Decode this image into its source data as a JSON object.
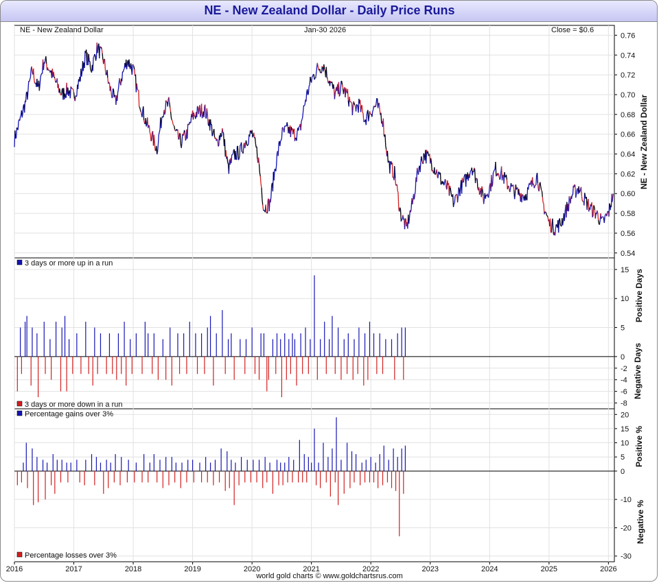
{
  "title": "NE - New Zealand Dollar - Daily Price Runs",
  "credit": "world gold charts © www.goldchartsrus.com",
  "colors": {
    "up": "#1414b4",
    "down": "#d21e1e",
    "price": "#000000",
    "title": "#1a1a9a",
    "grid": "#e1e1e1"
  },
  "chart_data": [
    {
      "type": "line",
      "info_left": "NE - New Zealand Dollar",
      "info_center": "Jan-30  2026",
      "info_right": "Close = $0.6",
      "ylabel": "NE - New Zealand Dollar",
      "ylim": [
        0.535,
        0.77
      ],
      "yticks": [
        "0.76",
        "0.74",
        "0.72",
        "0.70",
        "0.68",
        "0.66",
        "0.64",
        "0.62",
        "0.60",
        "0.58",
        "0.56",
        "0.54"
      ],
      "xticks": [
        "2016",
        "2017",
        "2018",
        "2019",
        "2020",
        "2021",
        "2022",
        "2023",
        "2024",
        "2025",
        "2026"
      ],
      "xlim": [
        2016.0,
        2026.1
      ],
      "series": [
        {
          "x": [
            2016.0,
            2016.1,
            2016.2,
            2016.3,
            2016.4,
            2016.5,
            2016.6,
            2016.7,
            2016.8,
            2016.9,
            2017.0,
            2017.1,
            2017.2,
            2017.3,
            2017.4,
            2017.5,
            2017.6,
            2017.7,
            2017.8,
            2017.9,
            2018.0,
            2018.1,
            2018.2,
            2018.3,
            2018.4,
            2018.5,
            2018.6,
            2018.7,
            2018.8,
            2018.9,
            2019.0,
            2019.1,
            2019.2,
            2019.3,
            2019.4,
            2019.5,
            2019.6,
            2019.7,
            2019.8,
            2019.9,
            2020.0,
            2020.1,
            2020.2,
            2020.3,
            2020.4,
            2020.5,
            2020.6,
            2020.7,
            2020.8,
            2020.9,
            2021.0,
            2021.1,
            2021.2,
            2021.3,
            2021.4,
            2021.5,
            2021.6,
            2021.7,
            2021.8,
            2021.9,
            2022.0,
            2022.1,
            2022.2,
            2022.3,
            2022.4,
            2022.5,
            2022.6,
            2022.7,
            2022.8,
            2022.9,
            2023.0,
            2023.1,
            2023.2,
            2023.3,
            2023.4,
            2023.5,
            2023.6,
            2023.7,
            2023.8,
            2023.9,
            2024.0,
            2024.1,
            2024.2,
            2024.3,
            2024.4,
            2024.5,
            2024.6,
            2024.7,
            2024.8,
            2024.9,
            2025.0,
            2025.1,
            2025.2,
            2025.3,
            2025.4,
            2025.5,
            2025.6,
            2025.7,
            2025.8,
            2025.9,
            2026.0,
            2026.08
          ],
          "y": [
            0.655,
            0.675,
            0.695,
            0.725,
            0.705,
            0.735,
            0.725,
            0.712,
            0.7,
            0.705,
            0.698,
            0.715,
            0.74,
            0.727,
            0.748,
            0.735,
            0.708,
            0.692,
            0.717,
            0.735,
            0.725,
            0.695,
            0.675,
            0.66,
            0.645,
            0.685,
            0.69,
            0.662,
            0.652,
            0.66,
            0.678,
            0.683,
            0.685,
            0.67,
            0.65,
            0.664,
            0.625,
            0.639,
            0.642,
            0.654,
            0.661,
            0.638,
            0.585,
            0.59,
            0.63,
            0.66,
            0.665,
            0.66,
            0.662,
            0.695,
            0.715,
            0.726,
            0.73,
            0.715,
            0.7,
            0.708,
            0.7,
            0.685,
            0.69,
            0.675,
            0.683,
            0.69,
            0.675,
            0.63,
            0.62,
            0.58,
            0.565,
            0.59,
            0.625,
            0.64,
            0.634,
            0.623,
            0.612,
            0.605,
            0.59,
            0.605,
            0.614,
            0.628,
            0.611,
            0.595,
            0.606,
            0.625,
            0.62,
            0.61,
            0.603,
            0.6,
            0.598,
            0.608,
            0.618,
            0.59,
            0.57,
            0.565,
            0.57,
            0.585,
            0.6,
            0.606,
            0.594,
            0.585,
            0.58,
            0.57,
            0.58,
            0.6
          ]
        }
      ]
    },
    {
      "type": "bar",
      "legend_top": "3 days or more up in a run",
      "legend_bottom": "3 days or more down in a run",
      "ylabel_top": "Positive Days",
      "ylabel_bottom": "Negative Days",
      "ylim": [
        -9,
        17
      ],
      "yticks": [
        "15",
        "10",
        "5",
        "0",
        "-2",
        "-4",
        "-6",
        "-8"
      ],
      "series": [
        {
          "name": "3 days or more up in a run",
          "x": [
            2016.1,
            2016.18,
            2016.21,
            2016.3,
            2016.38,
            2016.5,
            2016.6,
            2016.7,
            2016.8,
            2016.85,
            2016.92,
            2017.05,
            2017.2,
            2017.35,
            2017.45,
            2017.6,
            2017.75,
            2017.85,
            2017.95,
            2018.05,
            2018.2,
            2018.25,
            2018.35,
            2018.5,
            2018.62,
            2018.75,
            2018.85,
            2018.95,
            2019.05,
            2019.15,
            2019.25,
            2019.3,
            2019.4,
            2019.5,
            2019.6,
            2019.65,
            2019.8,
            2019.9,
            2020.0,
            2020.15,
            2020.2,
            2020.35,
            2020.42,
            2020.48,
            2020.55,
            2020.62,
            2020.68,
            2020.72,
            2020.82,
            2020.9,
            2020.98,
            2021.05,
            2021.15,
            2021.22,
            2021.3,
            2021.35,
            2021.45,
            2021.55,
            2021.62,
            2021.72,
            2021.8,
            2021.9,
            2021.98,
            2022.05,
            2022.15,
            2022.25,
            2022.35,
            2022.45,
            2022.52,
            2022.58
          ],
          "y": [
            5,
            6,
            7,
            5,
            4,
            6,
            3,
            6,
            5,
            7,
            3,
            4,
            6,
            5,
            4,
            4,
            4,
            6,
            3,
            4,
            6,
            4,
            4,
            3,
            5,
            4,
            4,
            6,
            4,
            4,
            5,
            7,
            4,
            8,
            3,
            4,
            3,
            3,
            5,
            4,
            4,
            3,
            4,
            3,
            4,
            3,
            4,
            3,
            4,
            5,
            3,
            14,
            3,
            6,
            3,
            7,
            5,
            3,
            4,
            3,
            5,
            4,
            6,
            4,
            4,
            3,
            3,
            4,
            5,
            5
          ]
        },
        {
          "name": "3 days or more down in a run",
          "x": [
            2016.05,
            2016.12,
            2016.28,
            2016.4,
            2016.52,
            2016.62,
            2016.78,
            2016.88,
            2016.98,
            2017.12,
            2017.25,
            2017.32,
            2017.4,
            2017.55,
            2017.65,
            2017.72,
            2017.8,
            2017.88,
            2017.98,
            2018.15,
            2018.32,
            2018.42,
            2018.55,
            2018.65,
            2018.78,
            2018.9,
            2019.08,
            2019.2,
            2019.35,
            2019.55,
            2019.7,
            2019.88,
            2020.05,
            2020.12,
            2020.25,
            2020.28,
            2020.4,
            2020.5,
            2020.58,
            2020.65,
            2020.75,
            2020.85,
            2020.95,
            2021.1,
            2021.25,
            2021.4,
            2021.5,
            2021.6,
            2021.7,
            2021.78,
            2021.88,
            2021.95,
            2022.1,
            2022.2,
            2022.4,
            2022.55
          ],
          "y": [
            -6,
            -3,
            -5,
            -7,
            -3,
            -4,
            -6,
            -6,
            -3,
            -3,
            -3,
            -5,
            -3,
            -3,
            -3,
            -4,
            -3,
            -5,
            -3,
            -3,
            -3,
            -4,
            -4,
            -5,
            -3,
            -3,
            -3,
            -3,
            -5,
            -3,
            -4,
            -3,
            -3,
            -4,
            -6,
            -4,
            -3,
            -7,
            -4,
            -3,
            -5,
            -3,
            -3,
            -4,
            -3,
            -3,
            -4,
            -3,
            -4,
            -3,
            -5,
            -4,
            -3,
            -3,
            -4,
            -4
          ]
        }
      ]
    },
    {
      "type": "bar",
      "legend_top": "Percentage gains over 3%",
      "legend_bottom": "Percentage losses over 3%",
      "ylabel_top": "Positive %",
      "ylabel_bottom": "Negative %",
      "ylim": [
        -32,
        22
      ],
      "yticks": [
        "20",
        "15",
        "10",
        "5",
        "0",
        "-10",
        "-20",
        "-30"
      ],
      "series": [
        {
          "name": "Percentage gains over 3%",
          "x": [
            2016.15,
            2016.2,
            2016.3,
            2016.38,
            2016.48,
            2016.55,
            2016.65,
            2016.72,
            2016.8,
            2016.88,
            2016.95,
            2017.05,
            2017.2,
            2017.3,
            2017.38,
            2017.45,
            2017.55,
            2017.62,
            2017.7,
            2017.8,
            2017.92,
            2018.05,
            2018.18,
            2018.28,
            2018.35,
            2018.45,
            2018.55,
            2018.65,
            2018.72,
            2018.82,
            2018.92,
            2019.0,
            2019.12,
            2019.22,
            2019.3,
            2019.38,
            2019.48,
            2019.58,
            2019.65,
            2019.72,
            2019.82,
            2019.92,
            2020.02,
            2020.12,
            2020.22,
            2020.3,
            2020.42,
            2020.48,
            2020.55,
            2020.62,
            2020.7,
            2020.8,
            2020.88,
            2020.95,
            2021.0,
            2021.05,
            2021.12,
            2021.2,
            2021.28,
            2021.35,
            2021.42,
            2021.5,
            2021.6,
            2021.68,
            2021.75,
            2021.85,
            2021.92,
            2022.0,
            2022.08,
            2022.15,
            2022.22,
            2022.3,
            2022.38,
            2022.45,
            2022.52,
            2022.58
          ],
          "y": [
            3,
            10,
            8,
            5,
            4,
            3,
            6,
            4,
            4,
            3,
            3,
            4,
            4,
            6,
            5,
            3,
            4,
            3,
            6,
            5,
            4,
            3,
            6,
            3,
            6,
            4,
            5,
            5,
            3,
            3,
            4,
            4,
            3,
            5,
            3,
            4,
            8,
            7,
            4,
            3,
            5,
            4,
            4,
            4,
            5,
            3,
            4,
            3,
            3,
            5,
            4,
            11,
            6,
            5,
            3,
            15,
            3,
            10,
            5,
            8,
            19,
            4,
            10,
            7,
            6,
            3,
            4,
            5,
            3,
            6,
            9,
            4,
            8,
            5,
            8,
            9
          ]
        },
        {
          "name": "Percentage losses over 3%",
          "x": [
            2016.05,
            2016.12,
            2016.22,
            2016.32,
            2016.4,
            2016.52,
            2016.62,
            2016.68,
            2016.78,
            2016.9,
            2017.1,
            2017.18,
            2017.35,
            2017.5,
            2017.58,
            2017.68,
            2017.78,
            2017.9,
            2018.02,
            2018.15,
            2018.25,
            2018.4,
            2018.5,
            2018.6,
            2018.7,
            2018.8,
            2018.9,
            2019.02,
            2019.15,
            2019.25,
            2019.35,
            2019.45,
            2019.55,
            2019.62,
            2019.7,
            2019.78,
            2019.88,
            2019.98,
            2020.08,
            2020.18,
            2020.25,
            2020.35,
            2020.45,
            2020.52,
            2020.6,
            2020.68,
            2020.78,
            2020.85,
            2020.92,
            2021.08,
            2021.15,
            2021.25,
            2021.32,
            2021.4,
            2021.45,
            2021.55,
            2021.65,
            2021.72,
            2021.82,
            2021.9,
            2021.98,
            2022.05,
            2022.12,
            2022.2,
            2022.28,
            2022.35,
            2022.42,
            2022.48,
            2022.55
          ],
          "y": [
            -5,
            -4,
            -6,
            -12,
            -11,
            -10,
            -5,
            -8,
            -4,
            -4,
            -4,
            -5,
            -5,
            -8,
            -6,
            -4,
            -5,
            -4,
            -4,
            -4,
            -4,
            -4,
            -6,
            -5,
            -4,
            -6,
            -4,
            -4,
            -4,
            -4,
            -5,
            -4,
            -7,
            -6,
            -12,
            -5,
            -4,
            -4,
            -4,
            -6,
            -4,
            -8,
            -5,
            -5,
            -4,
            -4,
            -4,
            -4,
            -4,
            -5,
            -6,
            -4,
            -9,
            -4,
            -12,
            -8,
            -6,
            -4,
            -5,
            -4,
            -4,
            -4,
            -6,
            -5,
            -4,
            -6,
            -7,
            -23,
            -8
          ]
        }
      ]
    }
  ]
}
